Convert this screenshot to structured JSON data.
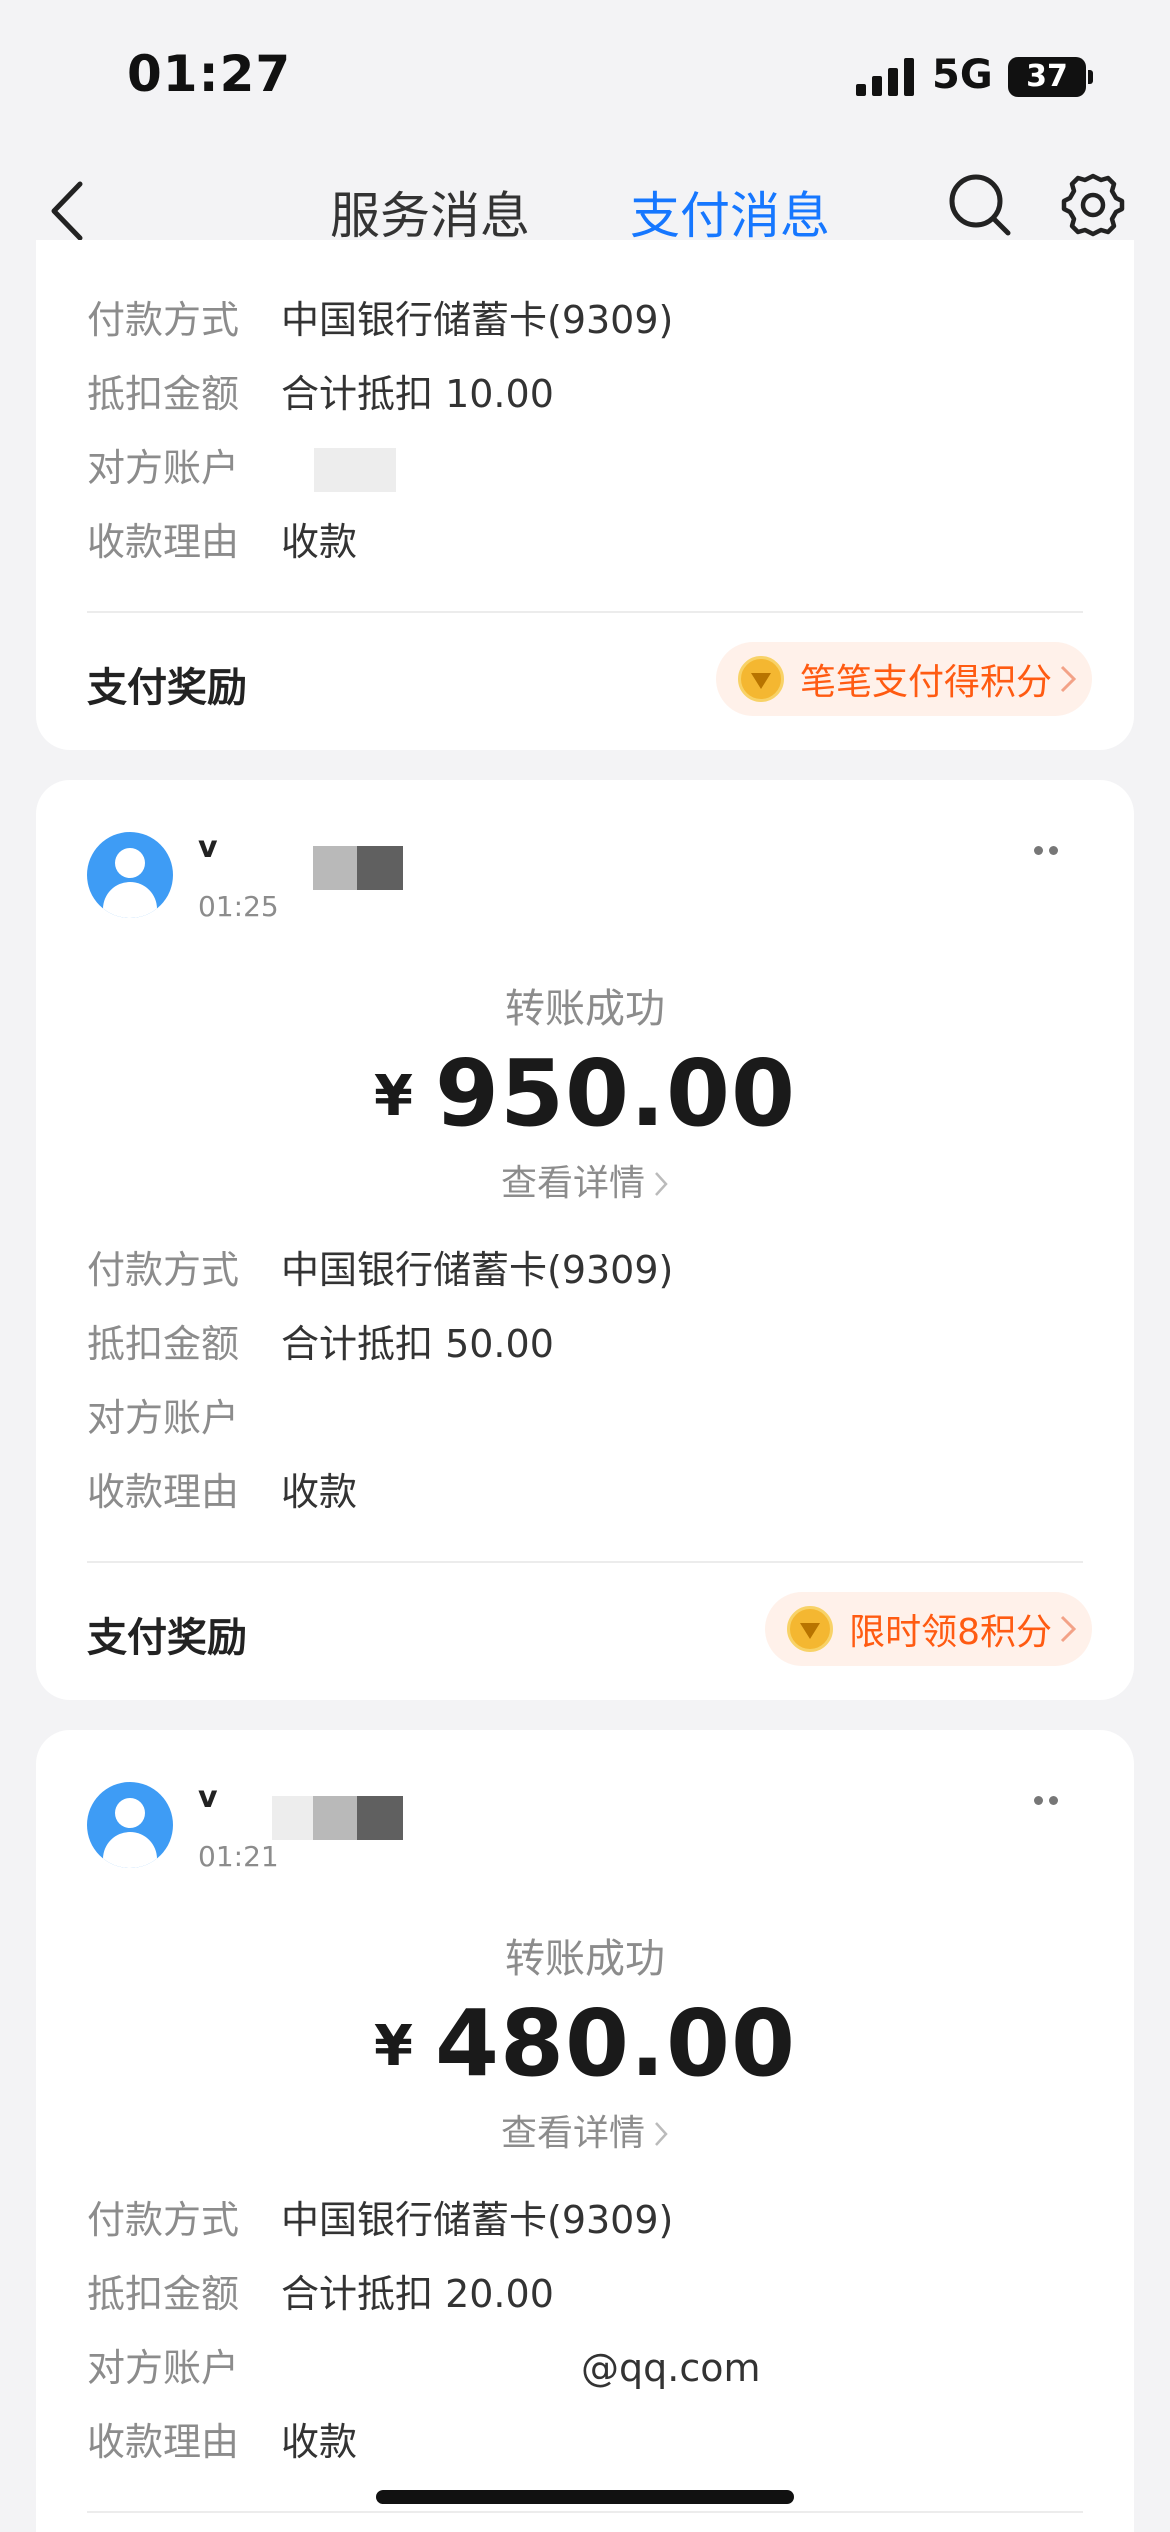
{
  "status_bar": {
    "time": "01:27",
    "network": "5G",
    "battery": "37"
  },
  "nav": {
    "tabs": [
      "服务消息",
      "支付消息"
    ],
    "active_tab": 1
  },
  "labels": {
    "payment_method": "付款方式",
    "deduction": "抵扣金额",
    "counterparty": "对方账户",
    "counterparty_partial": "对方账户",
    "reason": "收款理由",
    "reward_title": "支付奖励",
    "view_detail": "查看详情"
  },
  "cards": [
    {
      "payment_method": "中国银行储蓄卡(9309)",
      "deduction": "合计抵扣 10.00",
      "counterparty": "",
      "reason": "收款",
      "reward": "笔笔支付得积分"
    },
    {
      "sender": "v",
      "time": "01:25",
      "status": "转账成功",
      "currency": "¥",
      "amount": "950.00",
      "payment_method": "中国银行储蓄卡(9309)",
      "deduction": "合计抵扣 50.00",
      "counterparty": "",
      "reason": "收款",
      "reward": "限时领8积分"
    },
    {
      "sender": "v",
      "time": "01:21",
      "status": "转账成功",
      "currency": "¥",
      "amount": "480.00",
      "payment_method": "中国银行储蓄卡(9309)",
      "deduction": "合计抵扣 20.00",
      "counterparty": "@qq.com",
      "reason": "收款"
    }
  ],
  "colors": {
    "accent": "#1677ff",
    "reward": "#ff5b12",
    "avatar": "#3e9cf5"
  }
}
